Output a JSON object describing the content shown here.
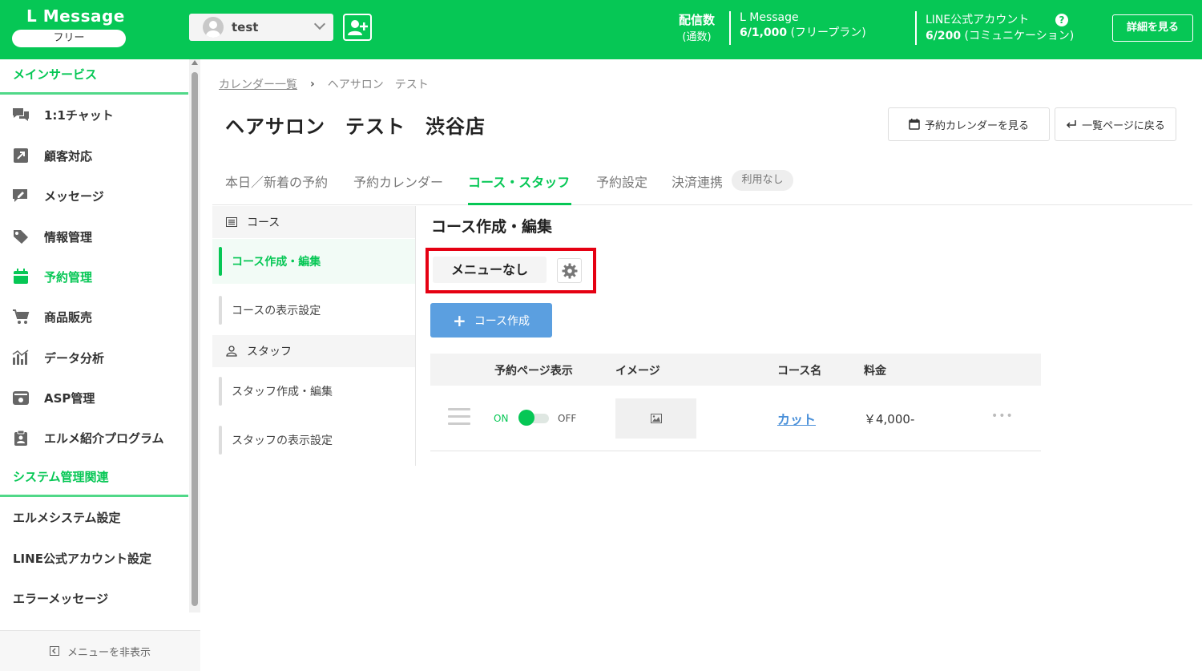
{
  "header": {
    "logo": "L Message",
    "plan": "フリー",
    "account_name": "test",
    "delivery_label": "配信数",
    "delivery_sub": "(通数)",
    "lmessage_label": "L Message",
    "lmessage_count": "6/1,000",
    "lmessage_plan": "(フリープラン)",
    "line_label": "LINE公式アカウント",
    "line_count": "6/200",
    "line_plan": "(コミュニケーション)",
    "help_glyph": "?",
    "details_button": "詳細を見る"
  },
  "sidebar": {
    "section_main": "メインサービス",
    "items": [
      {
        "label": "1:1チャット",
        "icon": "chat-icon"
      },
      {
        "label": "顧客対応",
        "icon": "arrow-box-icon"
      },
      {
        "label": "メッセージ",
        "icon": "message-edit-icon"
      },
      {
        "label": "情報管理",
        "icon": "tag-icon"
      },
      {
        "label": "予約管理",
        "icon": "calendar-icon"
      },
      {
        "label": "商品販売",
        "icon": "cart-icon"
      },
      {
        "label": "データ分析",
        "icon": "chart-icon"
      },
      {
        "label": "ASP管理",
        "icon": "asp-icon"
      },
      {
        "label": "エルメ紹介プログラム",
        "icon": "clipboard-icon"
      }
    ],
    "section_system": "システム管理関連",
    "system_items": [
      "エルメシステム設定",
      "LINE公式アカウント設定",
      "エラーメッセージ"
    ],
    "hide_menu": "メニューを非表示"
  },
  "breadcrumb": {
    "link": "カレンダー一覧",
    "current": "ヘアサロン　テスト"
  },
  "page_title": "ヘアサロン　テスト　渋谷店",
  "buttons": {
    "view_calendar": "予約カレンダーを見る",
    "back_to_list": "一覧ページに戻る"
  },
  "tabs": [
    {
      "label": "本日／新着の予約"
    },
    {
      "label": "予約カレンダー"
    },
    {
      "label": "コース・スタッフ"
    },
    {
      "label": "予約設定"
    },
    {
      "label": "決済連携"
    }
  ],
  "tab_badge": "利用なし",
  "subnav": {
    "course_head": "コース",
    "course_items": [
      "コース作成・編集",
      "コースの表示設定"
    ],
    "staff_head": "スタッフ",
    "staff_items": [
      "スタッフ作成・編集",
      "スタッフの表示設定"
    ]
  },
  "content": {
    "section_title": "コース作成・編集",
    "menu_chip": "メニューなし",
    "create_button": "コース作成",
    "table_headers": [
      "予約ページ表示",
      "イメージ",
      "コース名",
      "料金"
    ],
    "rows": [
      {
        "on": "ON",
        "off": "OFF",
        "course": "カット",
        "price": "￥4,000-",
        "more": "•••"
      }
    ]
  },
  "colors": {
    "brand_green": "#06c755",
    "highlight_red": "#e50012",
    "create_blue": "#5b9fe0"
  }
}
